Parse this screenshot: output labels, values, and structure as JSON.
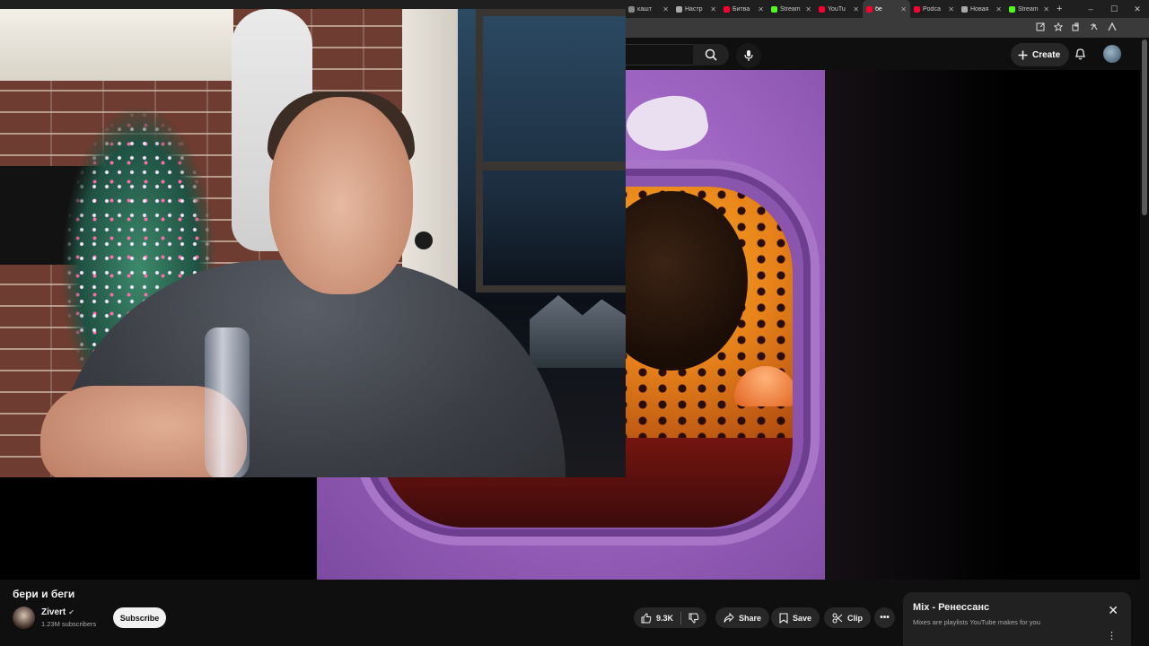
{
  "browser": {
    "tabs": [
      {
        "label": "кашт",
        "favicon_color": "#888888",
        "active": false
      },
      {
        "label": "Настр",
        "favicon_color": "#aaaaaa",
        "active": false
      },
      {
        "label": "Битва",
        "favicon_color": "#ff0033",
        "active": false
      },
      {
        "label": "Stream",
        "favicon_color": "#53fc18",
        "active": false
      },
      {
        "label": "YouTu",
        "favicon_color": "#ff0033",
        "active": false
      },
      {
        "label": "бе",
        "favicon_color": "#ff0033",
        "active": true
      },
      {
        "label": "Podca",
        "favicon_color": "#ff0033",
        "active": false
      },
      {
        "label": "Новая",
        "favicon_color": "#aaaaaa",
        "active": false
      },
      {
        "label": "Stream",
        "favicon_color": "#53fc18",
        "active": false
      }
    ],
    "new_tab": "+",
    "window_controls": {
      "minimize": "–",
      "maximize": "☐",
      "close": "✕"
    }
  },
  "masthead": {
    "create_label": "Create",
    "icons": [
      "search-icon",
      "mic-icon",
      "create-plus-icon",
      "bell-icon",
      "avatar"
    ]
  },
  "video": {
    "title": "бери и беги",
    "channel": "Zivert",
    "verified": "✔",
    "subscribers": "1.23M subscribers",
    "subscribe_label": "Subscribe",
    "likes": "9.3K",
    "share_label": "Share",
    "save_label": "Save",
    "clip_label": "Clip",
    "more_label": "•••"
  },
  "mix": {
    "title": "Mix - Ренессанс",
    "subtitle": "Mixes are playlists YouTube makes for you",
    "close": "✕",
    "menu": "⋮"
  },
  "colors": {
    "background": "#0f0f0f",
    "pill": "#272727",
    "text": "#f1f1f1",
    "muted": "#aaaaaa",
    "artwork_purple": "#9e64c1"
  }
}
